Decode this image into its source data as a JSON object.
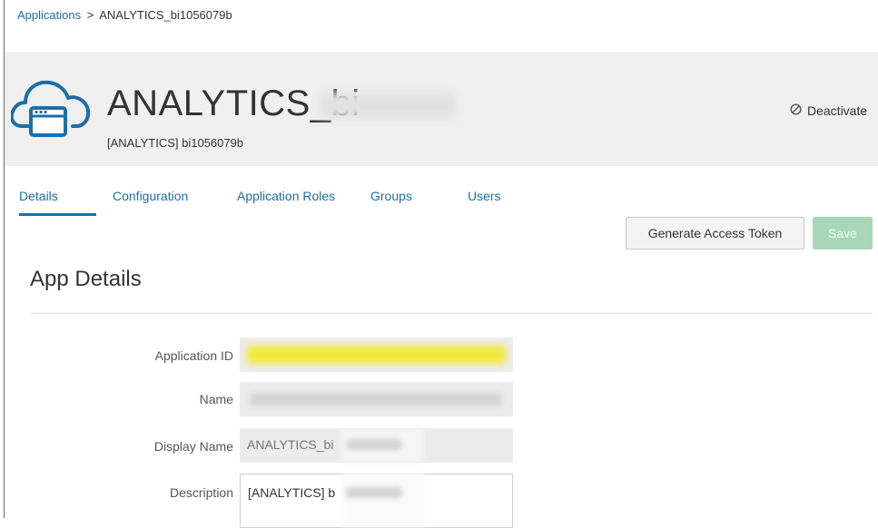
{
  "breadcrumb": {
    "root": "Applications",
    "separator": ">",
    "current": "ANALYTICS_bi1056079b"
  },
  "app": {
    "title_prefix": "ANALYTICS_bi",
    "subtitle": "[ANALYTICS] bi1056079b",
    "icon": "cloud-app-icon",
    "deactivate_label": "Deactivate",
    "deactivate_icon": "ban-icon"
  },
  "tabs": [
    {
      "label": "Details",
      "active": true
    },
    {
      "label": "Configuration",
      "active": false
    },
    {
      "label": "Application Roles",
      "active": false
    },
    {
      "label": "Groups",
      "active": false
    },
    {
      "label": "Users",
      "active": false
    }
  ],
  "actions": {
    "generate_token_label": "Generate Access Token",
    "save_label": "Save"
  },
  "section": {
    "title": "App Details"
  },
  "form": {
    "application_id": {
      "label": "Application ID",
      "value": ""
    },
    "name": {
      "label": "Name",
      "value": ""
    },
    "display_name": {
      "label": "Display Name",
      "value": "ANALYTICS_bi"
    },
    "description": {
      "label": "Description",
      "value": "[ANALYTICS] b"
    }
  },
  "colors": {
    "link": "#1b6ea8",
    "save_disabled": "#a7d7b6",
    "header_band": "#f0f0f0",
    "highlight": "#f2ea3a"
  }
}
